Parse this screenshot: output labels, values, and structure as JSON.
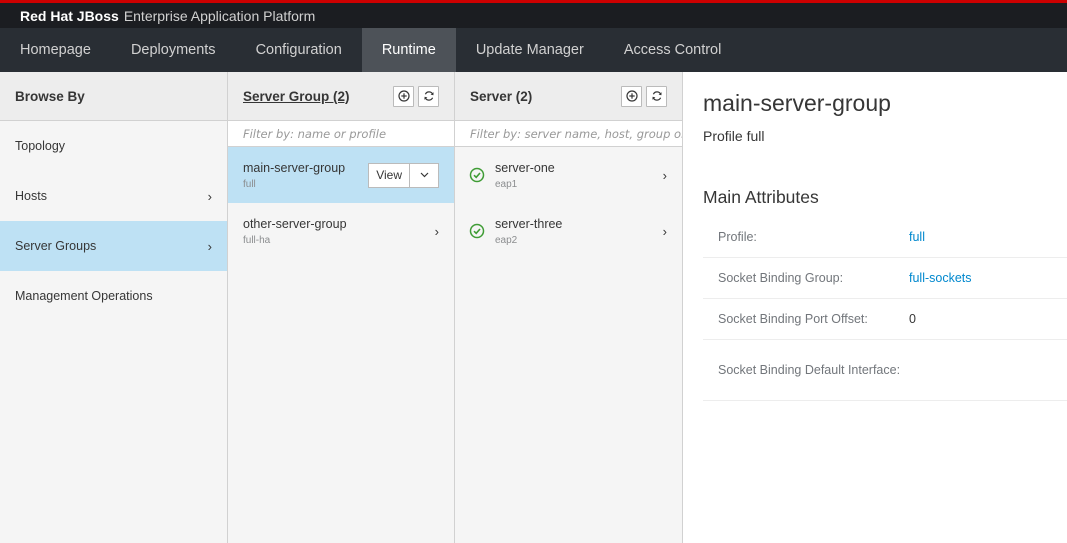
{
  "header": {
    "brand_strong": "Red Hat JBoss",
    "brand_rest": "Enterprise Application Platform"
  },
  "nav": {
    "items": [
      {
        "label": "Homepage"
      },
      {
        "label": "Deployments"
      },
      {
        "label": "Configuration"
      },
      {
        "label": "Runtime",
        "active": true
      },
      {
        "label": "Update Manager"
      },
      {
        "label": "Access Control"
      }
    ]
  },
  "browse": {
    "title": "Browse By",
    "items": [
      {
        "label": "Topology"
      },
      {
        "label": "Hosts"
      },
      {
        "label": "Server Groups",
        "selected": true
      },
      {
        "label": "Management Operations"
      }
    ]
  },
  "server_groups": {
    "title": "Server Group (2)",
    "filter_placeholder": "Filter by: name or profile",
    "view_label": "View",
    "items": [
      {
        "name": "main-server-group",
        "profile": "full",
        "selected": true
      },
      {
        "name": "other-server-group",
        "profile": "full-ha"
      }
    ],
    "add_icon": "add-circle-icon",
    "refresh_icon": "refresh-icon"
  },
  "servers": {
    "title": "Server (2)",
    "filter_placeholder": "Filter by: server name, host, group or st",
    "items": [
      {
        "name": "server-one",
        "group": "eap1",
        "status": "ok"
      },
      {
        "name": "server-three",
        "group": "eap2",
        "status": "ok"
      }
    ],
    "status_color": "#3f9c35"
  },
  "details": {
    "title": "main-server-group",
    "subtitle": "Profile full",
    "section_title": "Main Attributes",
    "attributes": [
      {
        "name": "Profile:",
        "value": "full",
        "link": true
      },
      {
        "name": "Socket Binding Group:",
        "value": "full-sockets",
        "link": true
      },
      {
        "name": "Socket Binding Port Offset:",
        "value": "0",
        "link": false
      },
      {
        "name": "Socket Binding Default Interface:",
        "value": "",
        "link": false
      }
    ]
  },
  "colors": {
    "accent": "#0088ce",
    "selected_bg": "#bee1f4",
    "topline": "#cc0000",
    "nav_bg": "#292e34"
  }
}
